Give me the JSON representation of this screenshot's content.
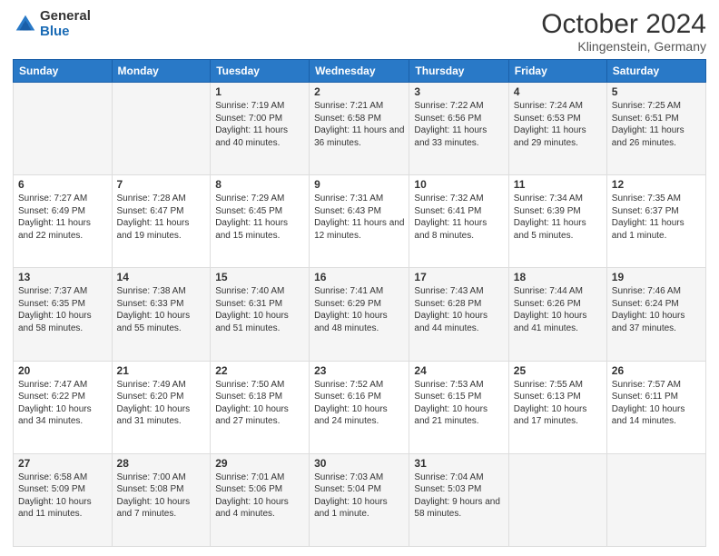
{
  "header": {
    "logo_general": "General",
    "logo_blue": "Blue",
    "month_title": "October 2024",
    "location": "Klingenstein, Germany"
  },
  "weekdays": [
    "Sunday",
    "Monday",
    "Tuesday",
    "Wednesday",
    "Thursday",
    "Friday",
    "Saturday"
  ],
  "weeks": [
    [
      {
        "day": "",
        "info": ""
      },
      {
        "day": "",
        "info": ""
      },
      {
        "day": "1",
        "info": "Sunrise: 7:19 AM\nSunset: 7:00 PM\nDaylight: 11 hours and 40 minutes."
      },
      {
        "day": "2",
        "info": "Sunrise: 7:21 AM\nSunset: 6:58 PM\nDaylight: 11 hours and 36 minutes."
      },
      {
        "day": "3",
        "info": "Sunrise: 7:22 AM\nSunset: 6:56 PM\nDaylight: 11 hours and 33 minutes."
      },
      {
        "day": "4",
        "info": "Sunrise: 7:24 AM\nSunset: 6:53 PM\nDaylight: 11 hours and 29 minutes."
      },
      {
        "day": "5",
        "info": "Sunrise: 7:25 AM\nSunset: 6:51 PM\nDaylight: 11 hours and 26 minutes."
      }
    ],
    [
      {
        "day": "6",
        "info": "Sunrise: 7:27 AM\nSunset: 6:49 PM\nDaylight: 11 hours and 22 minutes."
      },
      {
        "day": "7",
        "info": "Sunrise: 7:28 AM\nSunset: 6:47 PM\nDaylight: 11 hours and 19 minutes."
      },
      {
        "day": "8",
        "info": "Sunrise: 7:29 AM\nSunset: 6:45 PM\nDaylight: 11 hours and 15 minutes."
      },
      {
        "day": "9",
        "info": "Sunrise: 7:31 AM\nSunset: 6:43 PM\nDaylight: 11 hours and 12 minutes."
      },
      {
        "day": "10",
        "info": "Sunrise: 7:32 AM\nSunset: 6:41 PM\nDaylight: 11 hours and 8 minutes."
      },
      {
        "day": "11",
        "info": "Sunrise: 7:34 AM\nSunset: 6:39 PM\nDaylight: 11 hours and 5 minutes."
      },
      {
        "day": "12",
        "info": "Sunrise: 7:35 AM\nSunset: 6:37 PM\nDaylight: 11 hours and 1 minute."
      }
    ],
    [
      {
        "day": "13",
        "info": "Sunrise: 7:37 AM\nSunset: 6:35 PM\nDaylight: 10 hours and 58 minutes."
      },
      {
        "day": "14",
        "info": "Sunrise: 7:38 AM\nSunset: 6:33 PM\nDaylight: 10 hours and 55 minutes."
      },
      {
        "day": "15",
        "info": "Sunrise: 7:40 AM\nSunset: 6:31 PM\nDaylight: 10 hours and 51 minutes."
      },
      {
        "day": "16",
        "info": "Sunrise: 7:41 AM\nSunset: 6:29 PM\nDaylight: 10 hours and 48 minutes."
      },
      {
        "day": "17",
        "info": "Sunrise: 7:43 AM\nSunset: 6:28 PM\nDaylight: 10 hours and 44 minutes."
      },
      {
        "day": "18",
        "info": "Sunrise: 7:44 AM\nSunset: 6:26 PM\nDaylight: 10 hours and 41 minutes."
      },
      {
        "day": "19",
        "info": "Sunrise: 7:46 AM\nSunset: 6:24 PM\nDaylight: 10 hours and 37 minutes."
      }
    ],
    [
      {
        "day": "20",
        "info": "Sunrise: 7:47 AM\nSunset: 6:22 PM\nDaylight: 10 hours and 34 minutes."
      },
      {
        "day": "21",
        "info": "Sunrise: 7:49 AM\nSunset: 6:20 PM\nDaylight: 10 hours and 31 minutes."
      },
      {
        "day": "22",
        "info": "Sunrise: 7:50 AM\nSunset: 6:18 PM\nDaylight: 10 hours and 27 minutes."
      },
      {
        "day": "23",
        "info": "Sunrise: 7:52 AM\nSunset: 6:16 PM\nDaylight: 10 hours and 24 minutes."
      },
      {
        "day": "24",
        "info": "Sunrise: 7:53 AM\nSunset: 6:15 PM\nDaylight: 10 hours and 21 minutes."
      },
      {
        "day": "25",
        "info": "Sunrise: 7:55 AM\nSunset: 6:13 PM\nDaylight: 10 hours and 17 minutes."
      },
      {
        "day": "26",
        "info": "Sunrise: 7:57 AM\nSunset: 6:11 PM\nDaylight: 10 hours and 14 minutes."
      }
    ],
    [
      {
        "day": "27",
        "info": "Sunrise: 6:58 AM\nSunset: 5:09 PM\nDaylight: 10 hours and 11 minutes."
      },
      {
        "day": "28",
        "info": "Sunrise: 7:00 AM\nSunset: 5:08 PM\nDaylight: 10 hours and 7 minutes."
      },
      {
        "day": "29",
        "info": "Sunrise: 7:01 AM\nSunset: 5:06 PM\nDaylight: 10 hours and 4 minutes."
      },
      {
        "day": "30",
        "info": "Sunrise: 7:03 AM\nSunset: 5:04 PM\nDaylight: 10 hours and 1 minute."
      },
      {
        "day": "31",
        "info": "Sunrise: 7:04 AM\nSunset: 5:03 PM\nDaylight: 9 hours and 58 minutes."
      },
      {
        "day": "",
        "info": ""
      },
      {
        "day": "",
        "info": ""
      }
    ]
  ]
}
